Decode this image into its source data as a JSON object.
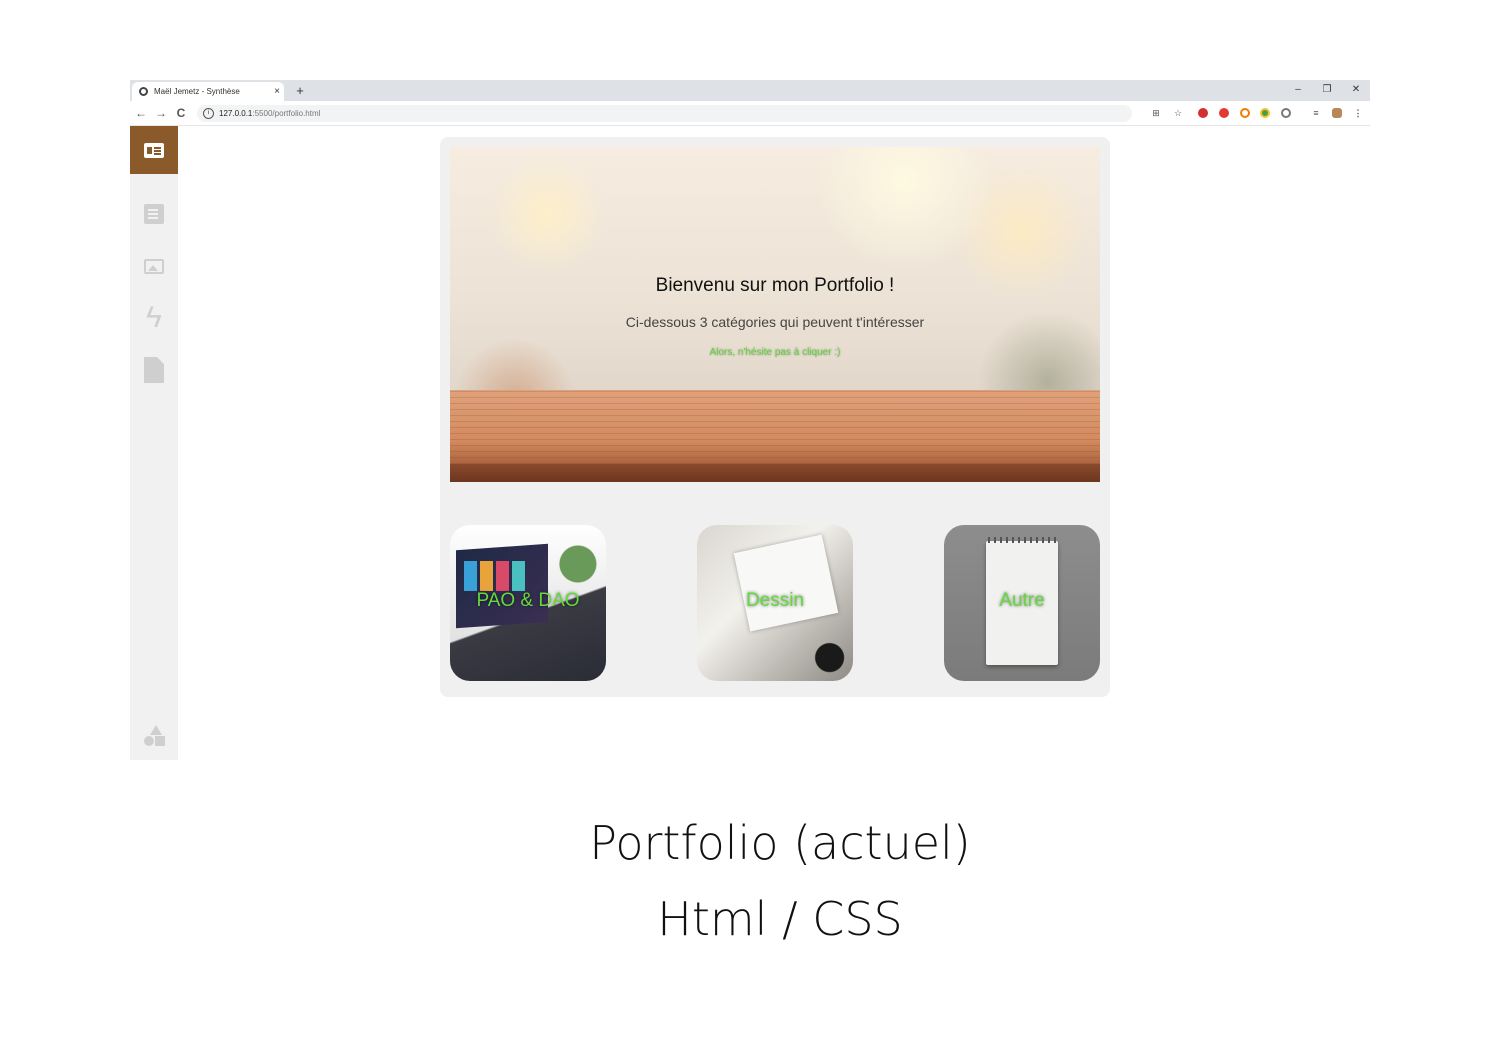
{
  "browser": {
    "tab_title": "Maël Jemetz - Synthèse",
    "tab_close": "×",
    "new_tab": "+",
    "window_controls": {
      "minimize": "–",
      "restore": "❐",
      "close": "✕"
    },
    "nav": {
      "back": "←",
      "forward": "→",
      "reload": "C"
    },
    "url_host": "127.0.0.1",
    "url_path": ":5500/portfolio.html"
  },
  "sidebar": {
    "items": [
      "profile-card-icon",
      "document-icon",
      "gallery-icon",
      "bolt-icon",
      "file-icon"
    ],
    "bottom": "shapes-icon",
    "accent_color": "#8b5a2b"
  },
  "hero": {
    "title": "Bienvenu sur mon Portfolio !",
    "subtitle": "Ci-dessous 3 catégories qui peuvent t'intéresser",
    "hint": "Alors, n'hésite pas à cliquer :)"
  },
  "categories": [
    {
      "label": "PAO & DAO"
    },
    {
      "label": "Dessin"
    },
    {
      "label": "Autre"
    }
  ],
  "label_color": "#63d93b",
  "caption": {
    "line1": "Portfolio (actuel)",
    "line2": "Html / CSS"
  }
}
